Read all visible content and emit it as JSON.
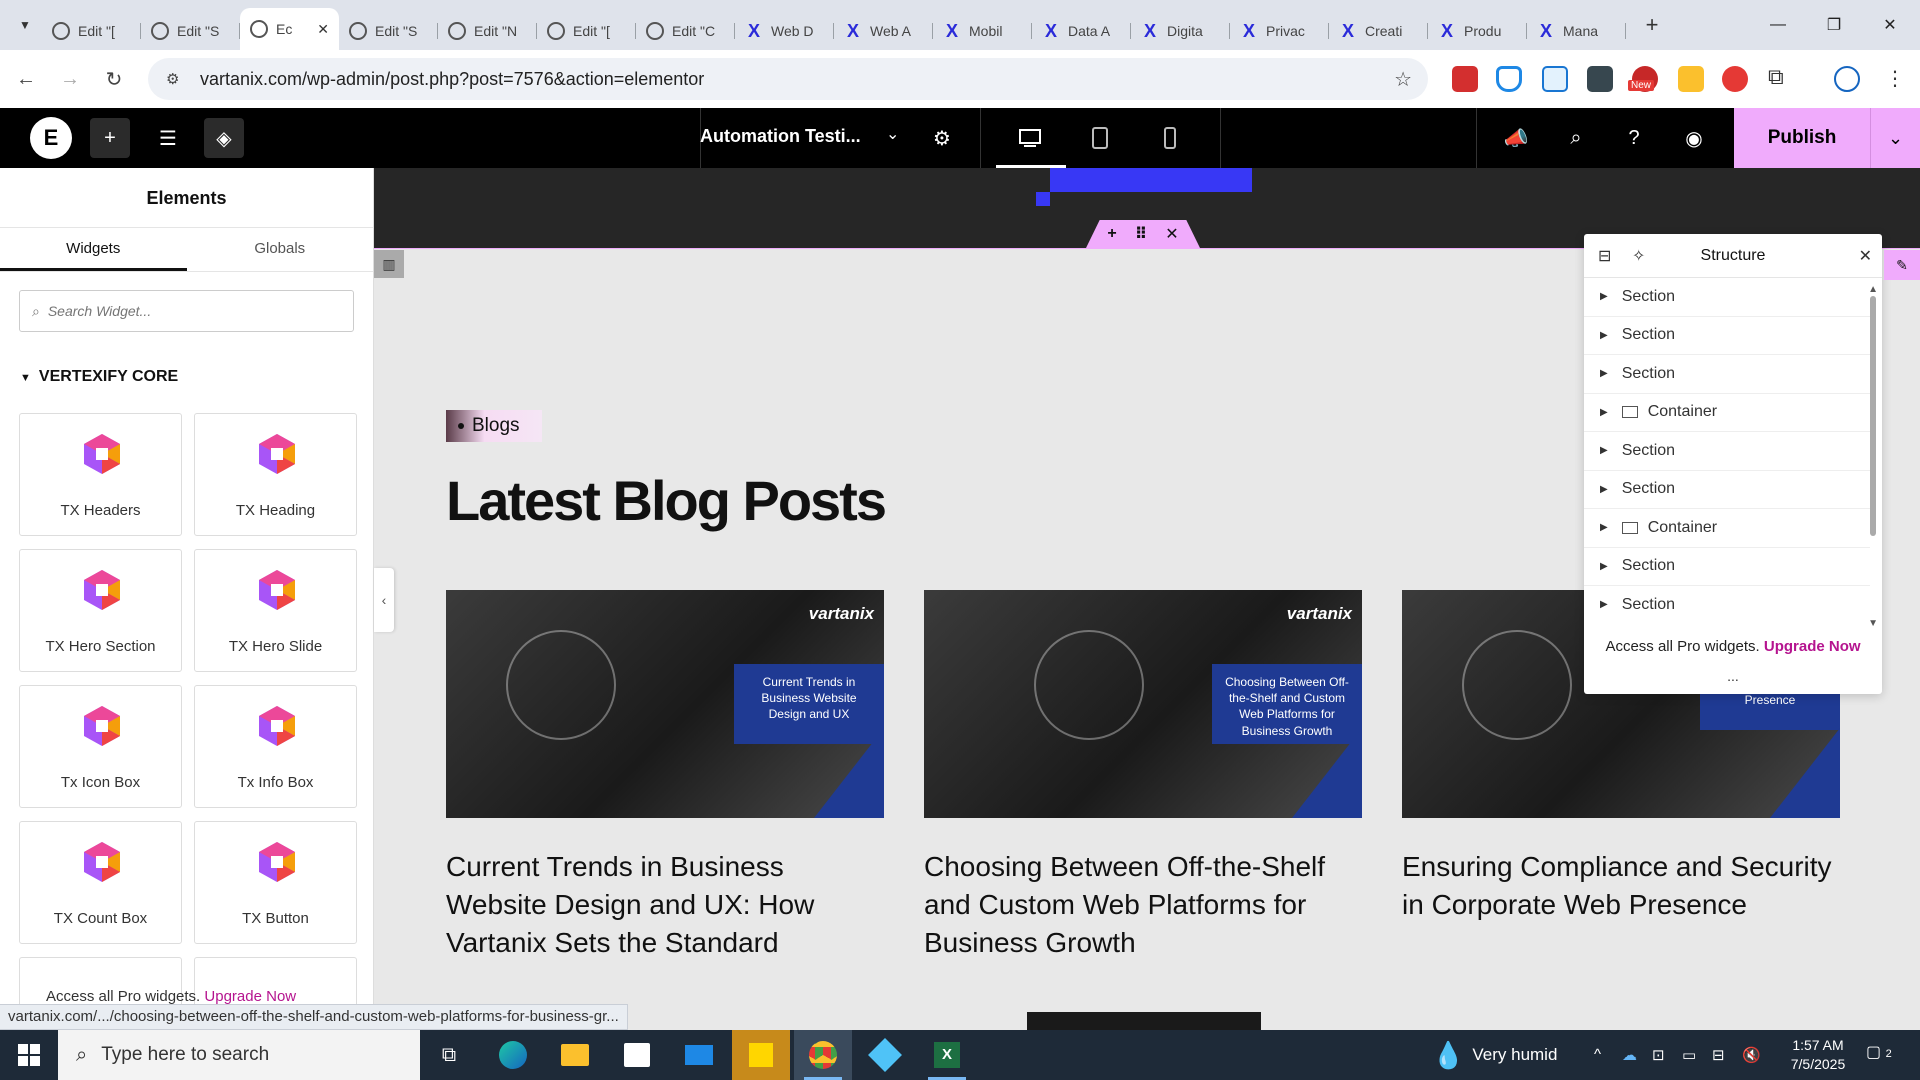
{
  "browser": {
    "tabs": [
      {
        "label": "Edit \"[",
        "icon": "wordpress"
      },
      {
        "label": "Edit \"S",
        "icon": "wordpress"
      },
      {
        "label": "Ec",
        "icon": "wordpress",
        "active": true
      },
      {
        "label": "Edit \"S",
        "icon": "wordpress"
      },
      {
        "label": "Edit \"N",
        "icon": "wordpress"
      },
      {
        "label": "Edit \"[",
        "icon": "wordpress"
      },
      {
        "label": "Edit \"C",
        "icon": "wordpress"
      },
      {
        "label": "Web D",
        "icon": "vartanix"
      },
      {
        "label": "Web A",
        "icon": "vartanix"
      },
      {
        "label": "Mobil",
        "icon": "vartanix"
      },
      {
        "label": "Data A",
        "icon": "vartanix"
      },
      {
        "label": "Digita",
        "icon": "vartanix"
      },
      {
        "label": "Privac",
        "icon": "vartanix"
      },
      {
        "label": "Creati",
        "icon": "vartanix"
      },
      {
        "label": "Produ",
        "icon": "vartanix"
      },
      {
        "label": "Mana",
        "icon": "vartanix"
      }
    ],
    "url": "vartanix.com/wp-admin/post.php?post=7576&action=elementor",
    "ext_new_badge": "New"
  },
  "elementor": {
    "doc_name": "Automation Testi...",
    "publish_label": "Publish",
    "panel": {
      "title": "Elements",
      "tabs": [
        "Widgets",
        "Globals"
      ],
      "search_placeholder": "Search Widget...",
      "category": "VERTEXIFY CORE",
      "widgets": [
        "TX Headers",
        "TX Heading",
        "TX Hero Section",
        "TX Hero Slide",
        "Tx Icon Box",
        "Tx Info Box",
        "TX Count Box",
        "TX Button"
      ],
      "footer_text": "Access all Pro widgets.",
      "footer_link": "Upgrade Now"
    },
    "structure": {
      "title": "Structure",
      "items": [
        {
          "label": "Section",
          "type": "section"
        },
        {
          "label": "Section",
          "type": "section"
        },
        {
          "label": "Section",
          "type": "section"
        },
        {
          "label": "Container",
          "type": "container"
        },
        {
          "label": "Section",
          "type": "section"
        },
        {
          "label": "Section",
          "type": "section"
        },
        {
          "label": "Container",
          "type": "container"
        },
        {
          "label": "Section",
          "type": "section"
        },
        {
          "label": "Section",
          "type": "section"
        }
      ],
      "footer_text": "Access all Pro widgets.",
      "footer_link": "Upgrade Now",
      "more": "..."
    }
  },
  "page": {
    "tag": "Blogs",
    "heading": "Latest Blog Posts",
    "cards": [
      {
        "brand": "vartanix",
        "overlay": "Current Trends in Business Website Design and UX",
        "title": "Current Trends in Business Website Design and UX: How Vartanix Sets the Standard"
      },
      {
        "brand": "vartanix",
        "overlay": "Choosing Between Off-the-Shelf and Custom Web Platforms for Business Growth",
        "title": "Choosing Between Off-the-Shelf and Custom Web Platforms for Business Growth"
      },
      {
        "brand": "",
        "overlay": "and Security in Corporate Web Presence",
        "title": "Ensuring Compliance and Security in Corporate Web Presence"
      }
    ]
  },
  "status_url": "vartanix.com/.../choosing-between-off-the-shelf-and-custom-web-platforms-for-business-gr...",
  "taskbar": {
    "search_placeholder": "Type here to search",
    "weather": "Very humid",
    "time": "1:57 AM",
    "date": "7/5/2025",
    "notif_count": "2"
  },
  "colors": {
    "accent_pink": "#f0abfc",
    "elementor_black": "#000000",
    "blue_brand": "#1f3a93",
    "upgrade_link": "#b5148f"
  }
}
